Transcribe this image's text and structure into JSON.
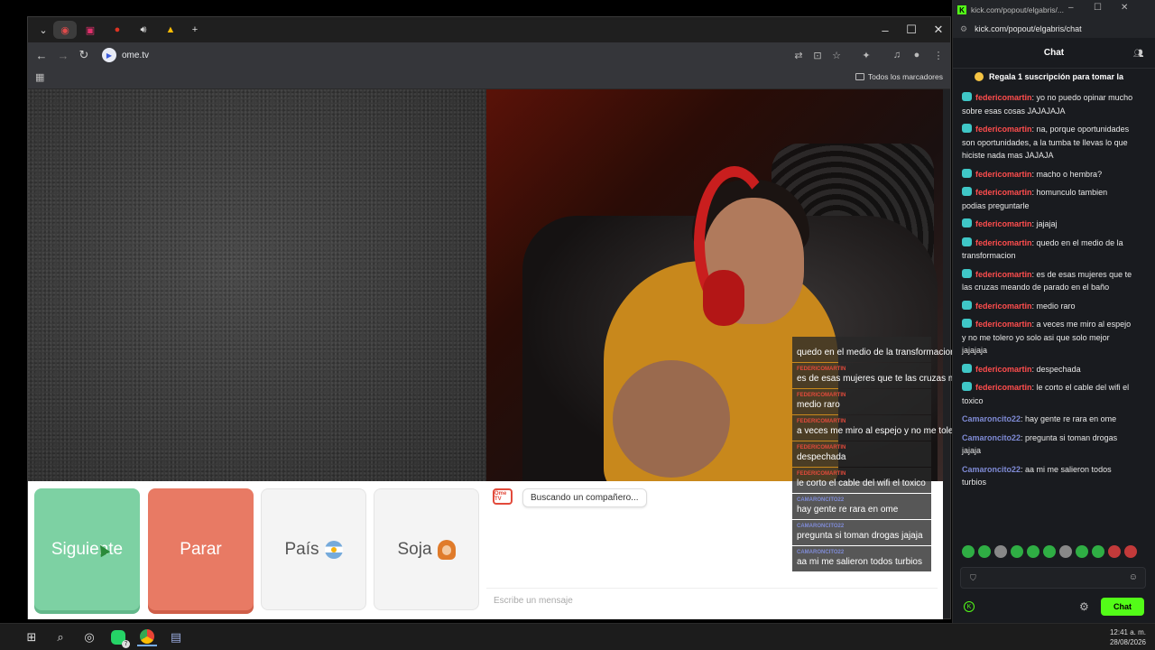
{
  "browser": {
    "url": "ome.tv",
    "bookmarks_folder": "Todos los marcadores"
  },
  "controls": {
    "next_label": "Siguiente",
    "stop_label": "Parar",
    "country_label": "País",
    "gender_label": "Soja"
  },
  "omechat": {
    "logo_text": "Ome TV",
    "status": "Buscando un compañero...",
    "input_placeholder": "Escribe un mensaje"
  },
  "overlay": [
    {
      "user": "",
      "text": "quedo en el medio de la transformacion"
    },
    {
      "user": "FEDERICOMARTIN",
      "text": "es de esas mujeres que te las cruzas meando de parado en el baño"
    },
    {
      "user": "FEDERICOMARTIN",
      "text": "medio raro"
    },
    {
      "user": "FEDERICOMARTIN",
      "text": "a veces me miro al espejo y no me tolero yo solo asi que solo mejor jajajaja"
    },
    {
      "user": "FEDERICOMARTIN",
      "text": "despechada"
    },
    {
      "user": "FEDERICOMARTIN",
      "text": "le corto el cable del wifi el toxico"
    },
    {
      "user": "CAMARONCITO22",
      "text": "hay gente re rara en ome"
    },
    {
      "user": "CAMARONCITO22",
      "text": "pregunta si toman drogas jajaja"
    },
    {
      "user": "CAMARONCITO22",
      "text": "aa mi me salieron todos turbios"
    }
  ],
  "kick": {
    "window_title": "kick.com/popout/elgabris/...",
    "url": "kick.com/popout/elgabris/chat",
    "header": "Chat",
    "pinned": "Regala 1 suscripción para tomar la",
    "messages": [
      {
        "user": "federicomartin",
        "text": ": yo no puedo opinar mucho sobre esas cosas JAJAJAJA",
        "color": "red"
      },
      {
        "user": "federicomartin",
        "text": ": na, porque oportunidades son oportunidades, a la tumba te llevas lo que hiciste nada mas JAJAJA",
        "color": "red"
      },
      {
        "user": "federicomartin",
        "text": ": macho o hembra?",
        "color": "red"
      },
      {
        "user": "federicomartin",
        "text": ": homunculo tambien podias preguntarle",
        "color": "red"
      },
      {
        "user": "federicomartin",
        "text": ": jajajaj",
        "color": "red"
      },
      {
        "user": "federicomartin",
        "text": ": quedo en el medio de la transformacion",
        "color": "red"
      },
      {
        "user": "federicomartin",
        "text": ": es de esas mujeres que te las cruzas meando de parado en el baño",
        "color": "red"
      },
      {
        "user": "federicomartin",
        "text": ": medio raro",
        "color": "red"
      },
      {
        "user": "federicomartin",
        "text": ": a veces me miro al espejo y no me tolero yo solo asi que solo mejor jajajaja",
        "color": "red"
      },
      {
        "user": "federicomartin",
        "text": ": despechada",
        "color": "red"
      },
      {
        "user": "federicomartin",
        "text": ": le corto el cable del wifi el toxico",
        "color": "red"
      },
      {
        "user": "Camaroncito22",
        "text": ": hay gente re rara en ome",
        "color": "blue"
      },
      {
        "user": "Camaroncito22",
        "text": ": pregunta si toman drogas jajaja",
        "color": "blue"
      },
      {
        "user": "Camaroncito22",
        "text": ": aa mi me salieron todos turbios",
        "color": "blue"
      }
    ],
    "chat_button": "Chat"
  },
  "taskbar": {
    "whatsapp_badge": "7",
    "time": "12:41 a. m.",
    "date": "28/08/2026"
  },
  "colors": {
    "next": "#7dd1a3",
    "stop": "#e87a64",
    "kick_green": "#53fc18"
  }
}
